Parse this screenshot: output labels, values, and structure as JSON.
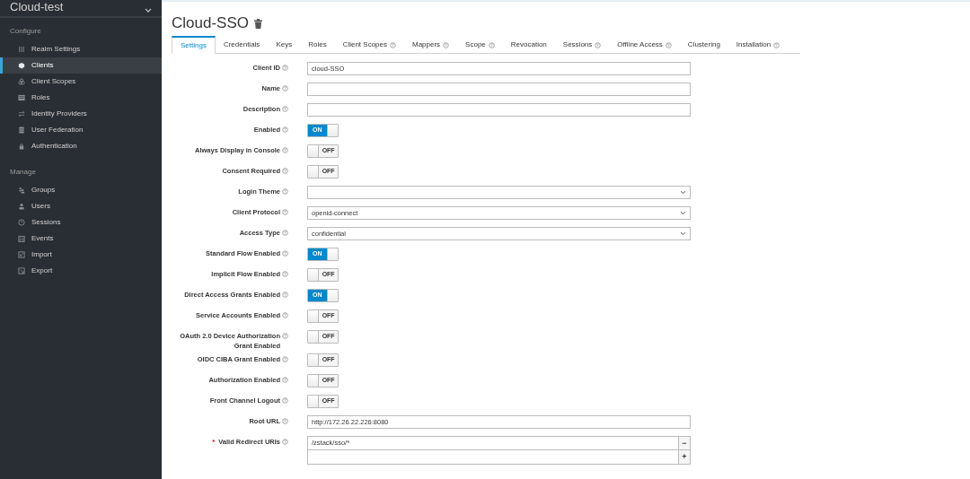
{
  "realm": {
    "name": "Cloud-test"
  },
  "sidebar": {
    "sections": [
      {
        "heading": "Configure",
        "items": [
          {
            "label": "Realm Settings",
            "selected": false
          },
          {
            "label": "Clients",
            "selected": true
          },
          {
            "label": "Client Scopes",
            "selected": false
          },
          {
            "label": "Roles",
            "selected": false
          },
          {
            "label": "Identity Providers",
            "selected": false
          },
          {
            "label": "User Federation",
            "selected": false
          },
          {
            "label": "Authentication",
            "selected": false
          }
        ]
      },
      {
        "heading": "Manage",
        "items": [
          {
            "label": "Groups",
            "selected": false
          },
          {
            "label": "Users",
            "selected": false
          },
          {
            "label": "Sessions",
            "selected": false
          },
          {
            "label": "Events",
            "selected": false
          },
          {
            "label": "Import",
            "selected": false
          },
          {
            "label": "Export",
            "selected": false
          }
        ]
      }
    ]
  },
  "page": {
    "title": "Cloud-SSO"
  },
  "tabs": [
    {
      "label": "Settings",
      "selected": true,
      "help": false
    },
    {
      "label": "Credentials",
      "selected": false,
      "help": false
    },
    {
      "label": "Keys",
      "selected": false,
      "help": false
    },
    {
      "label": "Roles",
      "selected": false,
      "help": false
    },
    {
      "label": "Client Scopes",
      "selected": false,
      "help": true
    },
    {
      "label": "Mappers",
      "selected": false,
      "help": true
    },
    {
      "label": "Scope",
      "selected": false,
      "help": true
    },
    {
      "label": "Revocation",
      "selected": false,
      "help": false
    },
    {
      "label": "Sessions",
      "selected": false,
      "help": true
    },
    {
      "label": "Offline Access",
      "selected": false,
      "help": true
    },
    {
      "label": "Clustering",
      "selected": false,
      "help": false
    },
    {
      "label": "Installation",
      "selected": false,
      "help": true
    }
  ],
  "form": [
    {
      "kind": "text",
      "label": "Client ID",
      "value": "cloud-SSO"
    },
    {
      "kind": "text",
      "label": "Name"
    },
    {
      "kind": "text",
      "label": "Description"
    },
    {
      "kind": "switch",
      "label": "Enabled",
      "on": true,
      "state_label": "ON"
    },
    {
      "kind": "switch",
      "label": "Always Display in Console",
      "on": false,
      "state_label": "OFF"
    },
    {
      "kind": "switch",
      "label": "Consent Required",
      "on": false,
      "state_label": "OFF"
    },
    {
      "kind": "select",
      "label": "Login Theme"
    },
    {
      "kind": "select",
      "label": "Client Protocol",
      "value": "openid-connect"
    },
    {
      "kind": "select",
      "label": "Access Type",
      "value": "confidential"
    },
    {
      "kind": "switch",
      "label": "Standard Flow Enabled",
      "on": true,
      "state_label": "ON"
    },
    {
      "kind": "switch",
      "label": "Implicit Flow Enabled",
      "on": false,
      "state_label": "OFF"
    },
    {
      "kind": "switch",
      "label": "Direct Access Grants Enabled",
      "on": true,
      "state_label": "ON"
    },
    {
      "kind": "switch",
      "label": "Service Accounts Enabled",
      "on": false,
      "state_label": "OFF"
    },
    {
      "kind": "switch",
      "label": "OAuth 2.0 Device Authorization Grant Enabled",
      "on": false,
      "state_label": "OFF"
    },
    {
      "kind": "switch",
      "label": "OIDC CIBA Grant Enabled",
      "on": false,
      "state_label": "OFF"
    },
    {
      "kind": "switch",
      "label": "Authorization Enabled",
      "on": false,
      "state_label": "OFF"
    },
    {
      "kind": "switch",
      "label": "Front Channel Logout",
      "on": false,
      "state_label": "OFF"
    },
    {
      "kind": "text",
      "label": "Root URL",
      "value": "http://172.26.22.226:8080"
    },
    {
      "kind": "multi",
      "label": "Valid Redirect URIs",
      "required_mark": "*",
      "values": [
        {
          "value": "/zstack/sso/*",
          "button": "−"
        }
      ],
      "new_entry": {
        "button": "+"
      }
    }
  ]
}
